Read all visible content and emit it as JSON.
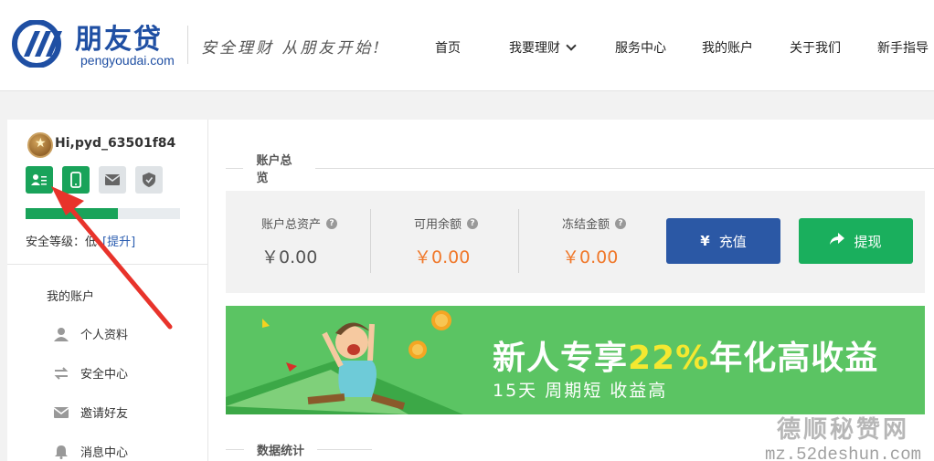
{
  "brand": {
    "name_cn": "朋友贷",
    "domain": "pengyoudai.com",
    "slogan": "安全理财 从朋友开始!"
  },
  "nav": [
    {
      "label": "首页"
    },
    {
      "label": "我要理财"
    },
    {
      "label": "服务中心"
    },
    {
      "label": "我的账户"
    },
    {
      "label": "关于我们"
    },
    {
      "label": "新手指导"
    }
  ],
  "user": {
    "greeting": "Hi,pyd_63501f84",
    "security_progress": 0.6,
    "security_label": "安全等级：低",
    "upgrade_label": "[提升]"
  },
  "sidebar": {
    "title": "我的账户",
    "items": [
      {
        "label": "个人资料",
        "icon": "person-icon"
      },
      {
        "label": "安全中心",
        "icon": "transfer-arrows-icon"
      },
      {
        "label": "邀请好友",
        "icon": "envelope-icon"
      },
      {
        "label": "消息中心",
        "icon": "bell-icon"
      }
    ]
  },
  "overview": {
    "title": "账户总览",
    "total_assets": {
      "label": "账户总资产",
      "value": "￥0.00"
    },
    "available": {
      "label": "可用余额",
      "value": "￥0.00"
    },
    "frozen": {
      "label": "冻结金额",
      "value": "￥0.00"
    },
    "recharge_label": "充值",
    "withdraw_label": "提现"
  },
  "banner": {
    "title_pre": "新人专享",
    "title_highlight": "22%",
    "title_post": "年化高收益",
    "subtitle": "15天 周期短 收益高"
  },
  "stats": {
    "title": "数据统计"
  },
  "watermark": {
    "line1": "德顺秘赞网",
    "line2": "mz.52deshun.com"
  },
  "colors": {
    "brand_blue": "#1f4fa3",
    "green": "#19a35a",
    "orange": "#f0782a",
    "recharge_blue": "#2b58a5"
  }
}
